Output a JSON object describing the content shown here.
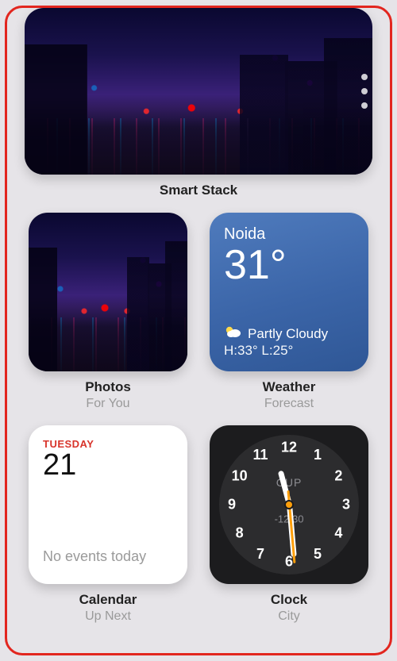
{
  "smartstack": {
    "title": "Smart Stack"
  },
  "photos": {
    "title": "Photos",
    "subtitle": "For You"
  },
  "weather": {
    "title": "Weather",
    "subtitle": "Forecast",
    "city": "Noida",
    "temp": "31°",
    "condition": "Partly Cloudy",
    "hilo": "H:33° L:25°"
  },
  "calendar": {
    "title": "Calendar",
    "subtitle": "Up Next",
    "dow": "TUESDAY",
    "dom": "21",
    "msg": "No events today"
  },
  "clock": {
    "title": "Clock",
    "subtitle": "City",
    "city": "CUP",
    "nums": [
      "12",
      "1",
      "2",
      "3",
      "4",
      "5",
      "6",
      "7",
      "8",
      "9",
      "10",
      "11"
    ],
    "time_hhmm": "-12:30",
    "hour_deg": 345,
    "min_deg": 175,
    "sec_deg": 175
  }
}
